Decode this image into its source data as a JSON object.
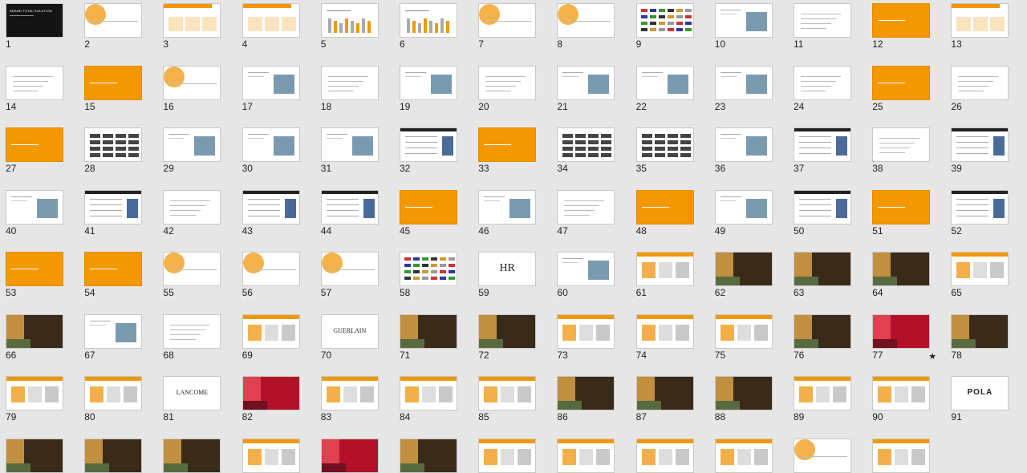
{
  "view": "slide-sorter",
  "columns": 13,
  "rows": 8,
  "hidden_marker": "★",
  "slides": [
    {
      "n": "1",
      "style": "dark",
      "text": "BRAND TOTAL SOLUTION"
    },
    {
      "n": "2",
      "style": "diagram"
    },
    {
      "n": "3",
      "style": "table-orange"
    },
    {
      "n": "4",
      "style": "table-orange"
    },
    {
      "n": "5",
      "style": "chart"
    },
    {
      "n": "6",
      "style": "chart"
    },
    {
      "n": "7",
      "style": "diagram"
    },
    {
      "n": "8",
      "style": "diagram"
    },
    {
      "n": "9",
      "style": "logos"
    },
    {
      "n": "10",
      "style": "photos"
    },
    {
      "n": "11",
      "style": "text"
    },
    {
      "n": "12",
      "style": "orange"
    },
    {
      "n": "13",
      "style": "table-orange"
    },
    {
      "n": "14",
      "style": "text"
    },
    {
      "n": "15",
      "style": "orange"
    },
    {
      "n": "16",
      "style": "diagram"
    },
    {
      "n": "17",
      "style": "photos"
    },
    {
      "n": "18",
      "style": "text"
    },
    {
      "n": "19",
      "style": "photos"
    },
    {
      "n": "20",
      "style": "text"
    },
    {
      "n": "21",
      "style": "photos"
    },
    {
      "n": "22",
      "style": "photos"
    },
    {
      "n": "23",
      "style": "photos"
    },
    {
      "n": "24",
      "style": "text"
    },
    {
      "n": "25",
      "style": "orange"
    },
    {
      "n": "26",
      "style": "text"
    },
    {
      "n": "27",
      "style": "orange"
    },
    {
      "n": "28",
      "style": "table-dark"
    },
    {
      "n": "29",
      "style": "photos"
    },
    {
      "n": "30",
      "style": "photos"
    },
    {
      "n": "31",
      "style": "photos"
    },
    {
      "n": "32",
      "style": "header-dark"
    },
    {
      "n": "33",
      "style": "orange"
    },
    {
      "n": "34",
      "style": "table-dark"
    },
    {
      "n": "35",
      "style": "table-dark"
    },
    {
      "n": "36",
      "style": "photos"
    },
    {
      "n": "37",
      "style": "header-dark"
    },
    {
      "n": "38",
      "style": "text"
    },
    {
      "n": "39",
      "style": "header-dark"
    },
    {
      "n": "40",
      "style": "photos"
    },
    {
      "n": "41",
      "style": "header-dark"
    },
    {
      "n": "42",
      "style": "text"
    },
    {
      "n": "43",
      "style": "header-dark"
    },
    {
      "n": "44",
      "style": "header-dark"
    },
    {
      "n": "45",
      "style": "orange"
    },
    {
      "n": "46",
      "style": "photos"
    },
    {
      "n": "47",
      "style": "text"
    },
    {
      "n": "48",
      "style": "orange"
    },
    {
      "n": "49",
      "style": "photos"
    },
    {
      "n": "50",
      "style": "header-dark"
    },
    {
      "n": "51",
      "style": "orange"
    },
    {
      "n": "52",
      "style": "header-dark"
    },
    {
      "n": "53",
      "style": "orange"
    },
    {
      "n": "54",
      "style": "orange"
    },
    {
      "n": "55",
      "style": "diagram"
    },
    {
      "n": "56",
      "style": "diagram"
    },
    {
      "n": "57",
      "style": "diagram"
    },
    {
      "n": "58",
      "style": "logos"
    },
    {
      "n": "59",
      "style": "logo",
      "logo": "HR"
    },
    {
      "n": "60",
      "style": "photos"
    },
    {
      "n": "61",
      "style": "header-orange"
    },
    {
      "n": "62",
      "style": "photo"
    },
    {
      "n": "63",
      "style": "photo"
    },
    {
      "n": "64",
      "style": "photo"
    },
    {
      "n": "65",
      "style": "header-orange"
    },
    {
      "n": "66",
      "style": "photo"
    },
    {
      "n": "67",
      "style": "photos"
    },
    {
      "n": "68",
      "style": "text"
    },
    {
      "n": "69",
      "style": "header-orange"
    },
    {
      "n": "70",
      "style": "logo",
      "logo": "GUERLAIN"
    },
    {
      "n": "71",
      "style": "photo"
    },
    {
      "n": "72",
      "style": "photo"
    },
    {
      "n": "73",
      "style": "header-orange"
    },
    {
      "n": "74",
      "style": "header-orange"
    },
    {
      "n": "75",
      "style": "header-orange"
    },
    {
      "n": "76",
      "style": "photo"
    },
    {
      "n": "77",
      "style": "photo-red",
      "hidden": true
    },
    {
      "n": "78",
      "style": "photo"
    },
    {
      "n": "79",
      "style": "header-orange"
    },
    {
      "n": "80",
      "style": "header-orange"
    },
    {
      "n": "81",
      "style": "logo",
      "logo": "LANCOME"
    },
    {
      "n": "82",
      "style": "photo-red"
    },
    {
      "n": "83",
      "style": "header-orange"
    },
    {
      "n": "84",
      "style": "header-orange"
    },
    {
      "n": "85",
      "style": "header-orange"
    },
    {
      "n": "86",
      "style": "photo"
    },
    {
      "n": "87",
      "style": "photo"
    },
    {
      "n": "88",
      "style": "photo"
    },
    {
      "n": "89",
      "style": "header-orange"
    },
    {
      "n": "90",
      "style": "header-orange"
    },
    {
      "n": "91",
      "style": "logo",
      "logo": "POLA"
    },
    {
      "n": "",
      "style": "photo"
    },
    {
      "n": "",
      "style": "photo"
    },
    {
      "n": "",
      "style": "photo"
    },
    {
      "n": "",
      "style": "header-orange"
    },
    {
      "n": "",
      "style": "photo-red"
    },
    {
      "n": "",
      "style": "photo"
    },
    {
      "n": "",
      "style": "header-orange"
    },
    {
      "n": "",
      "style": "header-orange"
    },
    {
      "n": "",
      "style": "header-orange"
    },
    {
      "n": "",
      "style": "header-orange"
    },
    {
      "n": "",
      "style": "diagram"
    },
    {
      "n": "",
      "style": "header-orange"
    }
  ]
}
